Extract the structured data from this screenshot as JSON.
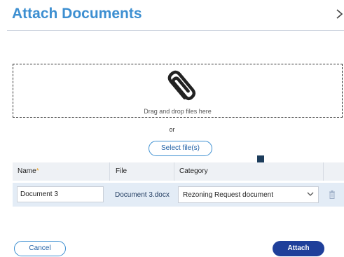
{
  "dialog": {
    "title": "Attach Documents",
    "close_label": "›"
  },
  "dropzone": {
    "icon": "paperclip-icon",
    "text": "Drag and drop files here"
  },
  "or_text": "or",
  "select_button": "Select file(s)",
  "table": {
    "headers": {
      "name": "Name",
      "required_marker": "*",
      "file": "File",
      "category": "Category"
    },
    "rows": [
      {
        "name": "Document 3",
        "file": "Document 3.docx",
        "category": "Rezoning Request document"
      }
    ]
  },
  "footer": {
    "cancel_label": "Cancel",
    "attach_label": "Attach"
  },
  "colors": {
    "title": "#3d8fd1",
    "primary_button": "#1f3f9a",
    "header_bg": "#eef1f5",
    "row_bg": "#e3ecf6",
    "arrow": "#1d3d5c"
  }
}
